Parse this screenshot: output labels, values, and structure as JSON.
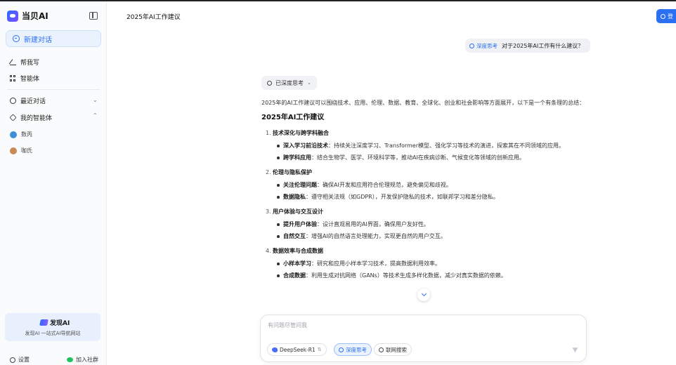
{
  "sidebar": {
    "brand": "当贝AI",
    "new_chat": "新建对话",
    "items": [
      {
        "label": "帮我写"
      },
      {
        "label": "智能体"
      }
    ],
    "recent_label": "最近对话",
    "my_agents_label": "我的智能体",
    "agents": [
      {
        "name": "数丙",
        "color": "#3f8fd8"
      },
      {
        "name": "咖氏",
        "color": "#c98a55"
      }
    ],
    "promo": {
      "title": "发现AI",
      "subtitle": "发现AI 一站式AI导航网站"
    },
    "settings_label": "设置",
    "community_label": "加入社群"
  },
  "header": {
    "title": "2025年AI工作建议",
    "login_label": "登"
  },
  "conversation": {
    "user_tag": "深度思考",
    "user_message": "对于2025年AI工作有什么建议？",
    "thought_label": "已深度思考",
    "intro": "2025年的AI工作建议可以围绕技术、应用、伦理、数据、教育、全球化、创业和社会影响等方面展开，以下是一个有条理的总结：",
    "heading": "2025年AI工作建议",
    "sections": [
      {
        "num": "1.",
        "title": "技术深化与跨学科融合",
        "bullets": [
          {
            "bold": "深入学习前沿技术",
            "text": "：持续关注深度学习、Transformer模型、强化学习等技术的演进，探索其在不同领域的应用。"
          },
          {
            "bold": "跨学科应用",
            "text": "：结合生物学、医学、环境科学等，推动AI在疾病诊断、气候变化等领域的创新应用。"
          }
        ]
      },
      {
        "num": "2.",
        "title": "伦理与隐私保护",
        "bullets": [
          {
            "bold": "关注伦理问题",
            "text": "：确保AI开发和应用符合伦理规范，避免偏见和歧视。"
          },
          {
            "bold": "数据隐私",
            "text": "：遵守相关法规（如GDPR），开发保护隐私的技术，如联邦学习和差分隐私。"
          }
        ]
      },
      {
        "num": "3.",
        "title": "用户体验与交互设计",
        "bullets": [
          {
            "bold": "提升用户体验",
            "text": "：设计直观易用的AI界面，确保用户友好性。"
          },
          {
            "bold": "自然交互",
            "text": "：增强AI的自然语言处理能力，实现更自然的用户交互。"
          }
        ]
      },
      {
        "num": "4.",
        "title": "数据效率与合成数据",
        "bullets": [
          {
            "bold": "小样本学习",
            "text": "：研究和应用小样本学习技术，提高数据利用效率。"
          },
          {
            "bold": "合成数据",
            "text": "：利用生成对抗网络（GANs）等技术生成多样化数据，减少对真实数据的依赖。"
          }
        ]
      }
    ]
  },
  "composer": {
    "placeholder": "有问题尽管问我",
    "model_label": "DeepSeek-R1",
    "deep_think_label": "深度思考",
    "web_search_label": "联网搜索"
  }
}
